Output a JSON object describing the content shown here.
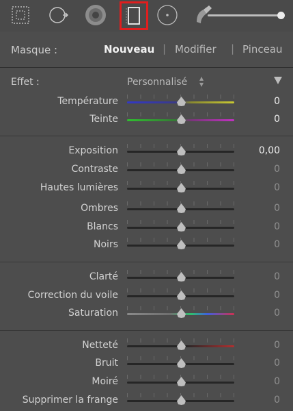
{
  "toolbar": {
    "tools": [
      {
        "name": "crop-overlay-icon"
      },
      {
        "name": "spot-removal-icon"
      },
      {
        "name": "red-eye-icon"
      },
      {
        "name": "graduated-filter-icon",
        "selected": true,
        "highlight": "#e01e1e"
      },
      {
        "name": "radial-filter-icon"
      },
      {
        "name": "adjustment-brush-icon"
      }
    ],
    "tool_size_level": 1.0
  },
  "mask": {
    "label": "Masque :",
    "new_label": "Nouveau",
    "separator": "|",
    "edit_label": "Modifier",
    "brush_label": "Pinceau"
  },
  "effect": {
    "label": "Effet :",
    "value": "Personnalisé"
  },
  "groups": [
    {
      "sliders": [
        {
          "id": "temperature",
          "label": "Température",
          "value": "0",
          "gradient": "linear-gradient(to right,#3238c8,#3a3a8a 45%,#8a8a30 60%,#c8c832)",
          "bright": true
        },
        {
          "id": "tint",
          "label": "Teinte",
          "value": "0",
          "gradient": "linear-gradient(to right,#2fbf2f,#357a35 45%,#7a357a 60%,#c032c0)",
          "bright": true
        }
      ]
    },
    {
      "sliders": [
        {
          "id": "exposure",
          "label": "Exposition",
          "value": "0,00",
          "bright": true
        },
        {
          "id": "contrast",
          "label": "Contraste",
          "value": "0"
        },
        {
          "id": "highlights",
          "label": "Hautes lumières",
          "value": "0"
        },
        {
          "id": "shadows",
          "label": "Ombres",
          "value": "0"
        },
        {
          "id": "whites",
          "label": "Blancs",
          "value": "0"
        },
        {
          "id": "blacks",
          "label": "Noirs",
          "value": "0"
        }
      ]
    },
    {
      "sliders": [
        {
          "id": "clarity",
          "label": "Clarté",
          "value": "0"
        },
        {
          "id": "dehaze",
          "label": "Correction du voile",
          "value": "0"
        },
        {
          "id": "saturation",
          "label": "Saturation",
          "value": "0",
          "gradient": "linear-gradient(to right,#8a8a8a,#6f6f6f 40%,#2fbf6f 60%,#3f5fe0 75%,#d03050)"
        }
      ]
    },
    {
      "sliders": [
        {
          "id": "sharpness",
          "label": "Netteté",
          "value": "0",
          "gradient": "linear-gradient(to right,#262626,#262626 55%,#b03030)"
        },
        {
          "id": "noise",
          "label": "Bruit",
          "value": "0"
        },
        {
          "id": "moire",
          "label": "Moiré",
          "value": "0"
        },
        {
          "id": "defringe",
          "label": "Supprimer la frange",
          "value": "0"
        }
      ]
    }
  ]
}
